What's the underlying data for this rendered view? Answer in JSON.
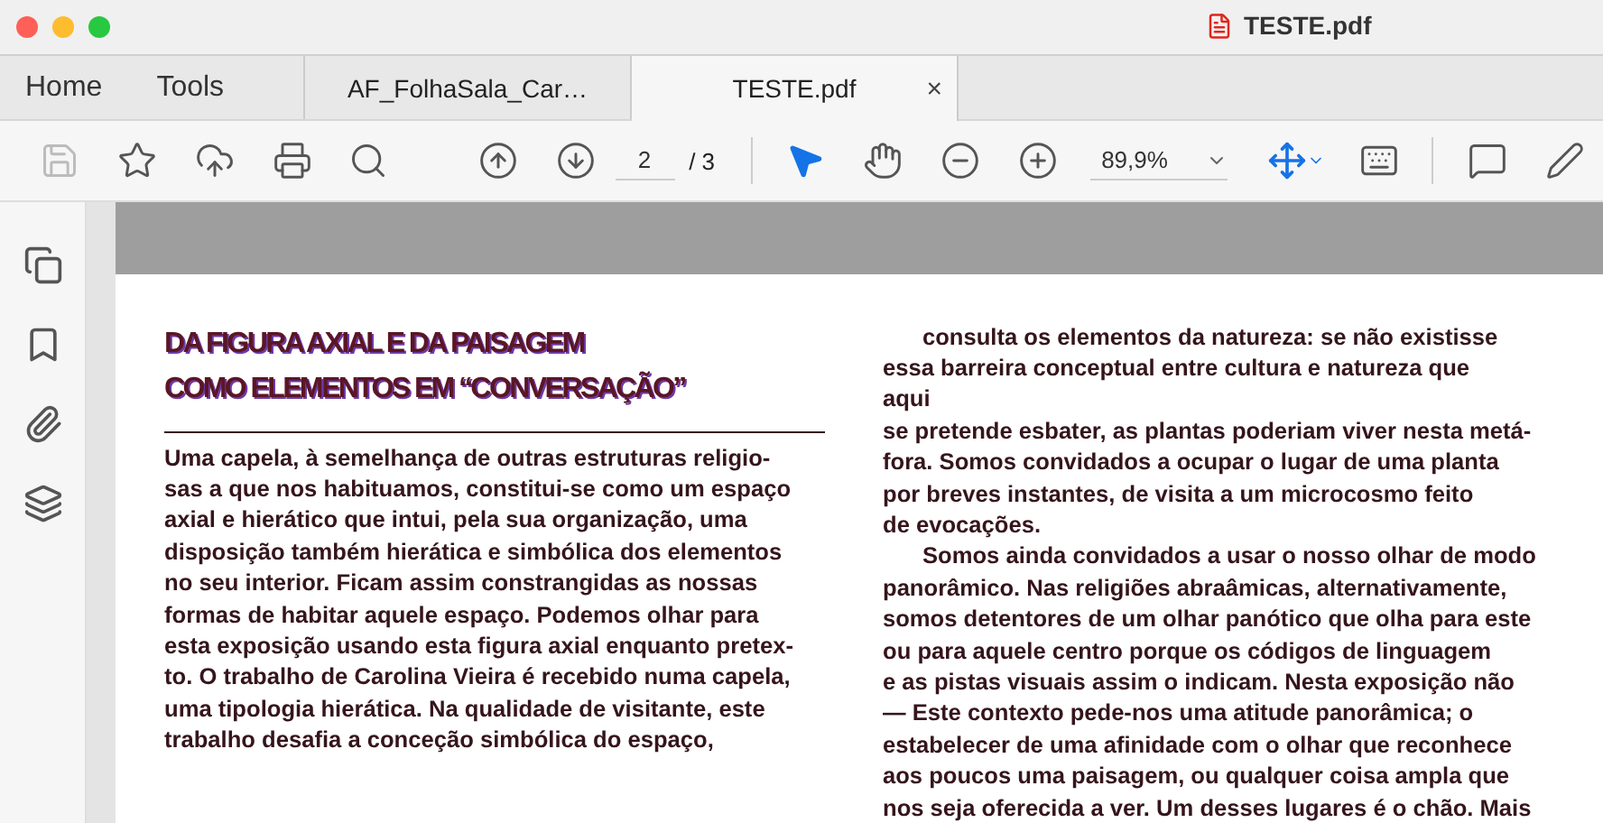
{
  "window": {
    "title": "TESTE.pdf"
  },
  "nav": [
    {
      "label": "Home"
    },
    {
      "label": "Tools"
    }
  ],
  "tabs": [
    {
      "label": "AF_FolhaSala_Car…",
      "selected": false
    },
    {
      "label": "TESTE.pdf",
      "selected": true,
      "close": "×"
    }
  ],
  "toolbar": {
    "page": "2",
    "total": "/ 3",
    "zoom": "89,9%",
    "select_tool_selected": true
  },
  "document": {
    "title_lines": [
      "DA FIGURA AXIAL E DA PAISAGEM",
      "COMO ELEMENTOS EM “CONVERSAÇÃO”"
    ],
    "left_lines": [
      "Uma capela, à semelhança de outras estruturas religio-",
      "sas a que nos habituamos, constitui-se como um espaço",
      "axial e hierático que intui, pela sua organização, uma",
      "disposição também hierática e simbólica dos elementos",
      "no seu interior. Ficam assim constrangidas as nossas",
      "formas de habitar aquele espaço. Podemos olhar para",
      "esta exposição usando esta figura axial enquanto pretex-",
      "to. O trabalho de Carolina Vieira é recebido numa capela,",
      "uma tipologia hierática. Na qualidade de visitante, este",
      "trabalho desafia a conceção simbólica do espaço,"
    ],
    "right_paragraphs": [
      {
        "indent": true,
        "lines": [
          "consulta os elementos da natureza:  se não existisse",
          "essa barreira conceptual entre cultura e natureza que",
          "aqui",
          "se pretende esbater, as plantas poderiam viver nesta metá-",
          "fora. Somos convidados a ocupar o lugar de uma planta",
          "por breves instantes, de visita a um microcosmo feito",
          "de evocações."
        ]
      },
      {
        "indent": true,
        "lines": [
          "Somos ainda convidados a usar o nosso olhar de modo",
          "panorâmico. Nas religiões abraâmicas, alternativamente,",
          "somos detentores de um olhar panótico que olha para este",
          "ou para aquele centro porque os códigos de linguagem",
          "e as pistas visuais assim o indicam. Nesta exposição não"
        ]
      },
      {
        "indent": false,
        "lines": [
          "— Este contexto pede-nos uma atitude panorâmica; o",
          "estabelecer de uma afinidade com o olhar que reconhece",
          "aos poucos uma paisagem, ou qualquer coisa ampla que",
          "nos seja oferecida a ver. Um desses lugares é o chão. Mais"
        ]
      }
    ]
  }
}
